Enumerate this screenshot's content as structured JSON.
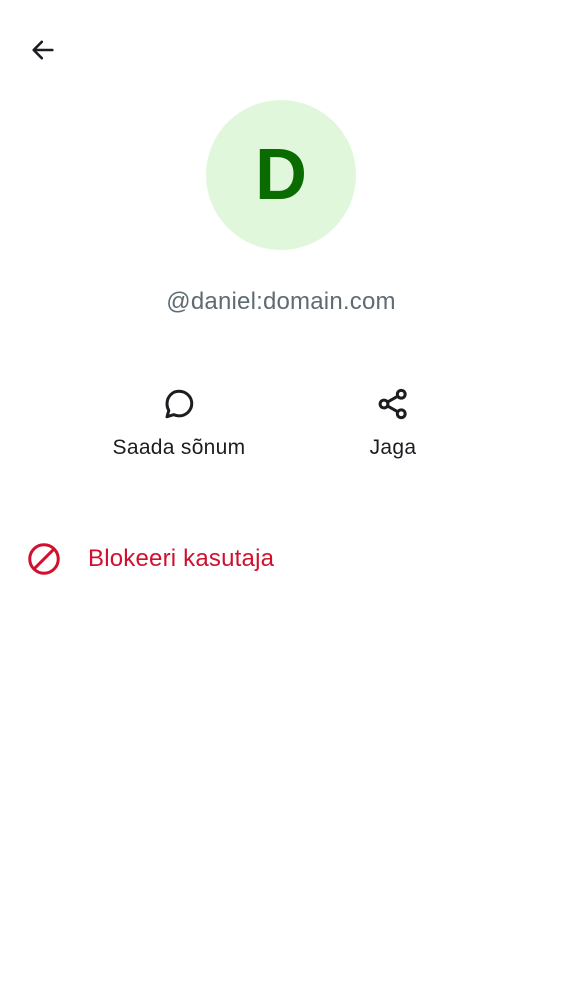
{
  "header": {
    "back_icon": "arrow-left-icon"
  },
  "profile": {
    "avatar_initial": "D",
    "avatar_bg_color": "#e0f7dc",
    "avatar_text_color": "#0a6b00",
    "user_id": "@daniel:domain.com"
  },
  "actions": {
    "message": {
      "label": "Saada sõnum",
      "icon": "chat-bubble-icon"
    },
    "share": {
      "label": "Jaga",
      "icon": "share-icon"
    }
  },
  "block": {
    "label": "Blokeeri kasutaja",
    "icon": "block-icon",
    "color": "#d0102e"
  }
}
